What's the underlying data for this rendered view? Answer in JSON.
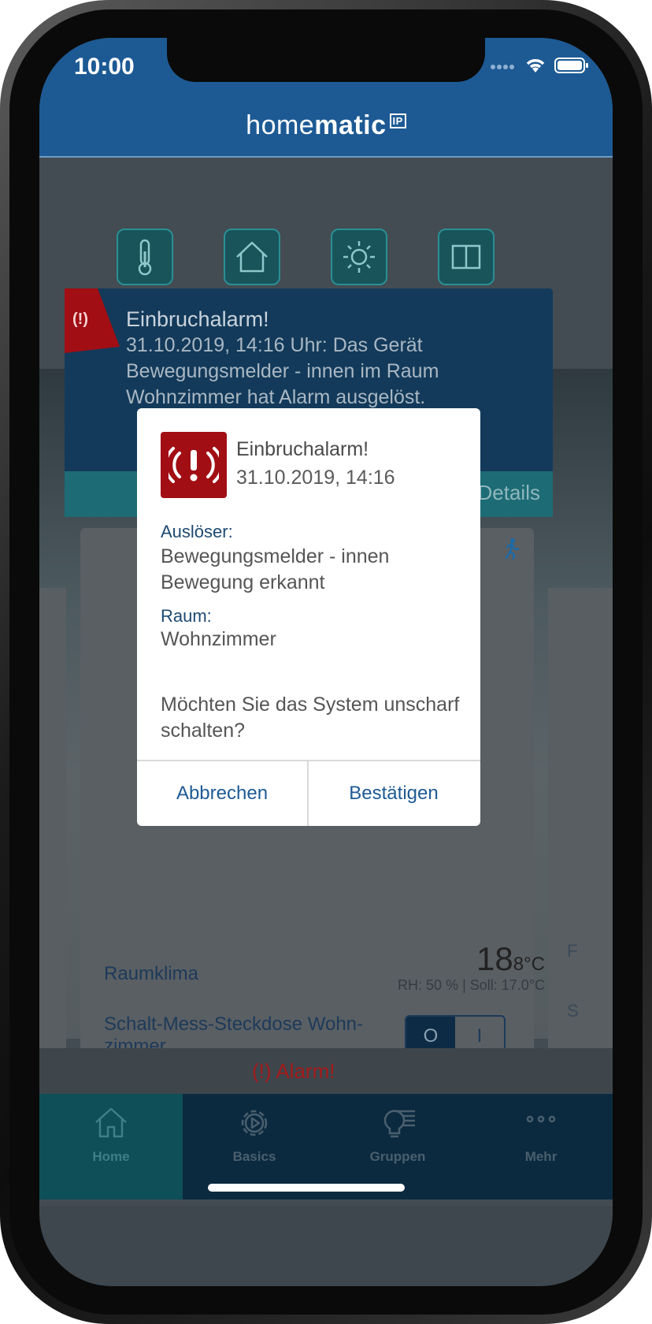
{
  "status": {
    "time": "10:00"
  },
  "app": {
    "brand_light": "home",
    "brand_bold": "matic",
    "brand_badge": "IP"
  },
  "banner": {
    "icon_text": "(!)",
    "title": "Einbruchalarm!",
    "message": "31.10.2019, 14:16 Uhr: Das Gerät Bewegungsmelder - innen im Raum Wohnzimmer hat Alarm ausgelöst.",
    "details_label": "Details"
  },
  "card": {
    "raumklima_label": "Raumklima",
    "temp_main": "18",
    "temp_small": "8°C",
    "rh": "RH: 50 % | Soll: 17.0°C",
    "steckdose_label": "Schalt-Mess-Steckdose Wohn-zimmer",
    "toggle_off": "O",
    "toggle_on": "I",
    "right_f": "F",
    "right_s": "S"
  },
  "alarm_strip": {
    "text": "(!) Alarm!"
  },
  "tabs": [
    {
      "label": "Home",
      "icon": "home-icon"
    },
    {
      "label": "Basics",
      "icon": "gear-icon"
    },
    {
      "label": "Gruppen",
      "icon": "lightbulb-icon"
    },
    {
      "label": "Mehr",
      "icon": "more-icon"
    }
  ],
  "dialog": {
    "title": "Einbruchalarm!",
    "date": "31.10.2019, 14:16",
    "trigger_label": "Auslöser:",
    "trigger_value_1": "Bewegungsmelder - innen",
    "trigger_value_2": "Bewegung erkannt",
    "room_label": "Raum:",
    "room_value": "Wohnzimmer",
    "question": "Möchten Sie das System unscharf schalten?",
    "cancel": "Abbrechen",
    "confirm": "Bestätigen"
  },
  "colors": {
    "brand_blue": "#1d5a94",
    "alarm_red": "#a10e14",
    "teal": "#0e4f58"
  }
}
